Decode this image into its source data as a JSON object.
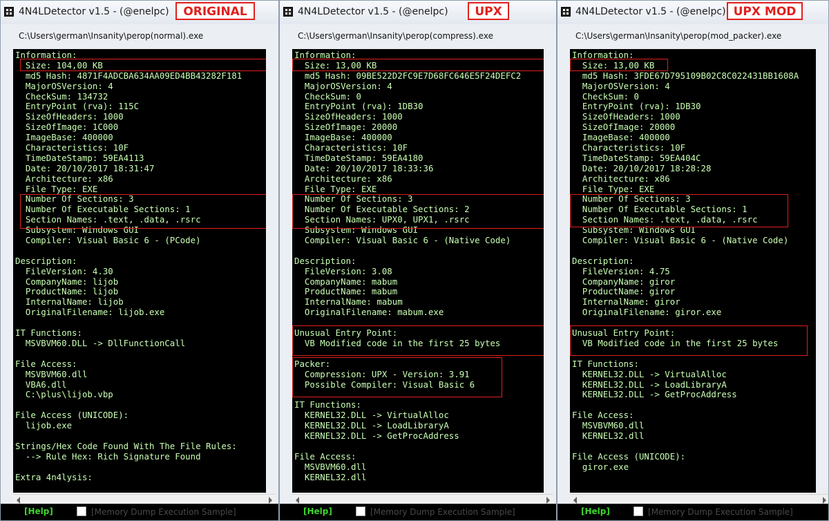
{
  "windows": [
    {
      "title": "4N4LDetector v1.5 - (@enelpc)",
      "tag": "ORIGINAL",
      "path": "C:\\Users\\german\\Insanity\\perop(normal).exe",
      "help_label": "[Help]",
      "checkbox_label": "[Memory Dump Execution Sample]",
      "lines": [
        "Information:",
        "  Size: 104,00 KB",
        "  md5 Hash: 4871F4ADCBA634AA09ED4BB43282F181",
        "  MajorOSVersion: 4",
        "  CheckSum: 134732",
        "  EntryPoint (rva): 115C",
        "  SizeOfHeaders: 1000",
        "  SizeOfImage: 1C000",
        "  ImageBase: 400000",
        "  Characteristics: 10F",
        "  TimeDateStamp: 59EA4113",
        "  Date: 20/10/2017 18:31:47",
        "  Architecture: x86",
        "  File Type: EXE",
        "  Number Of Sections: 3",
        "  Number Of Executable Sections: 1",
        "  Section Names: .text, .data, .rsrc",
        "  Subsystem: Windows GUI",
        "  Compiler: Visual Basic 6 - (PCode)",
        "",
        "Description:",
        "  FileVersion: 4.30",
        "  CompanyName: lijob",
        "  ProductName: lijob",
        "  InternalName: lijob",
        "  OriginalFilename: lijob.exe",
        "",
        "IT Functions:",
        "  MSVBVM60.DLL -> DllFunctionCall",
        "",
        "File Access:",
        "  MSVBVM60.dll",
        "  VBA6.dll",
        "  C:\\plus\\lijob.vbp",
        "",
        "File Access (UNICODE):",
        "  lijob.exe",
        "",
        "Strings/Hex Code Found With The File Rules:",
        "  --> Rule Hex: Rich Signature Found",
        "",
        "Extra 4n4lysis:"
      ]
    },
    {
      "title": "4N4LDetector v1.5 - (@enelpc)",
      "tag": "UPX",
      "path": "C:\\Users\\german\\Insanity\\perop(compress).exe",
      "help_label": "[Help]",
      "checkbox_label": "[Memory Dump Execution Sample]",
      "lines": [
        "Information:",
        "  Size: 13,00 KB",
        "  md5 Hash: 09BE522D2FC9E7D68FC646E5F24DEFC2",
        "  MajorOSVersion: 4",
        "  CheckSum: 0",
        "  EntryPoint (rva): 1DB30",
        "  SizeOfHeaders: 1000",
        "  SizeOfImage: 20000",
        "  ImageBase: 400000",
        "  Characteristics: 10F",
        "  TimeDateStamp: 59EA4180",
        "  Date: 20/10/2017 18:33:36",
        "  Architecture: x86",
        "  File Type: EXE",
        "  Number Of Sections: 3",
        "  Number Of Executable Sections: 2",
        "  Section Names: UPX0, UPX1, .rsrc",
        "  Subsystem: Windows GUI",
        "  Compiler: Visual Basic 6 - (Native Code)",
        "",
        "Description:",
        "  FileVersion: 3.08",
        "  CompanyName: mabum",
        "  ProductName: mabum",
        "  InternalName: mabum",
        "  OriginalFilename: mabum.exe",
        "",
        "Unusual Entry Point:",
        "  VB Modified code in the first 25 bytes",
        "",
        "Packer:",
        "  Compression: UPX - Version: 3.91",
        "  Possible Compiler: Visual Basic 6",
        "",
        "IT Functions:",
        "  KERNEL32.DLL -> VirtualAlloc",
        "  KERNEL32.DLL -> LoadLibraryA",
        "  KERNEL32.DLL -> GetProcAddress",
        "",
        "File Access:",
        "  MSVBVM60.dll",
        "  KERNEL32.dll"
      ]
    },
    {
      "title": "4N4LDetector v1.5 - (@enelpc)",
      "tag": "UPX MOD",
      "path": "C:\\Users\\german\\Insanity\\perop(mod_packer).exe",
      "help_label": "[Help]",
      "checkbox_label": "[Memory Dump Execution Sample]",
      "lines": [
        "Information:",
        "  Size: 13,00 KB",
        "  md5 Hash: 3FDE67D795109B02C8C022431BB1608A",
        "  MajorOSVersion: 4",
        "  CheckSum: 0",
        "  EntryPoint (rva): 1DB30",
        "  SizeOfHeaders: 1000",
        "  SizeOfImage: 20000",
        "  ImageBase: 400000",
        "  Characteristics: 10F",
        "  TimeDateStamp: 59EA404C",
        "  Date: 20/10/2017 18:28:28",
        "  Architecture: x86",
        "  File Type: EXE",
        "  Number Of Sections: 3",
        "  Number Of Executable Sections: 1",
        "  Section Names: .text, .data, .rsrc",
        "  Subsystem: Windows GUI",
        "  Compiler: Visual Basic 6 - (Native Code)",
        "",
        "Description:",
        "  FileVersion: 4.75",
        "  CompanyName: giror",
        "  ProductName: giror",
        "  InternalName: giror",
        "  OriginalFilename: giror.exe",
        "",
        "Unusual Entry Point:",
        "  VB Modified code in the first 25 bytes",
        "",
        "IT Functions:",
        "  KERNEL32.DLL -> VirtualAlloc",
        "  KERNEL32.DLL -> LoadLibraryA",
        "  KERNEL32.DLL -> GetProcAddress",
        "",
        "File Access:",
        "  MSVBVM60.dll",
        "  KERNEL32.dll",
        "",
        "File Access (UNICODE):",
        "  giror.exe"
      ]
    }
  ],
  "colors": {
    "console_text": "#c9ffb3",
    "console_bg": "#000000",
    "highlight": "#e0201c",
    "help_text": "#3bd62a"
  }
}
